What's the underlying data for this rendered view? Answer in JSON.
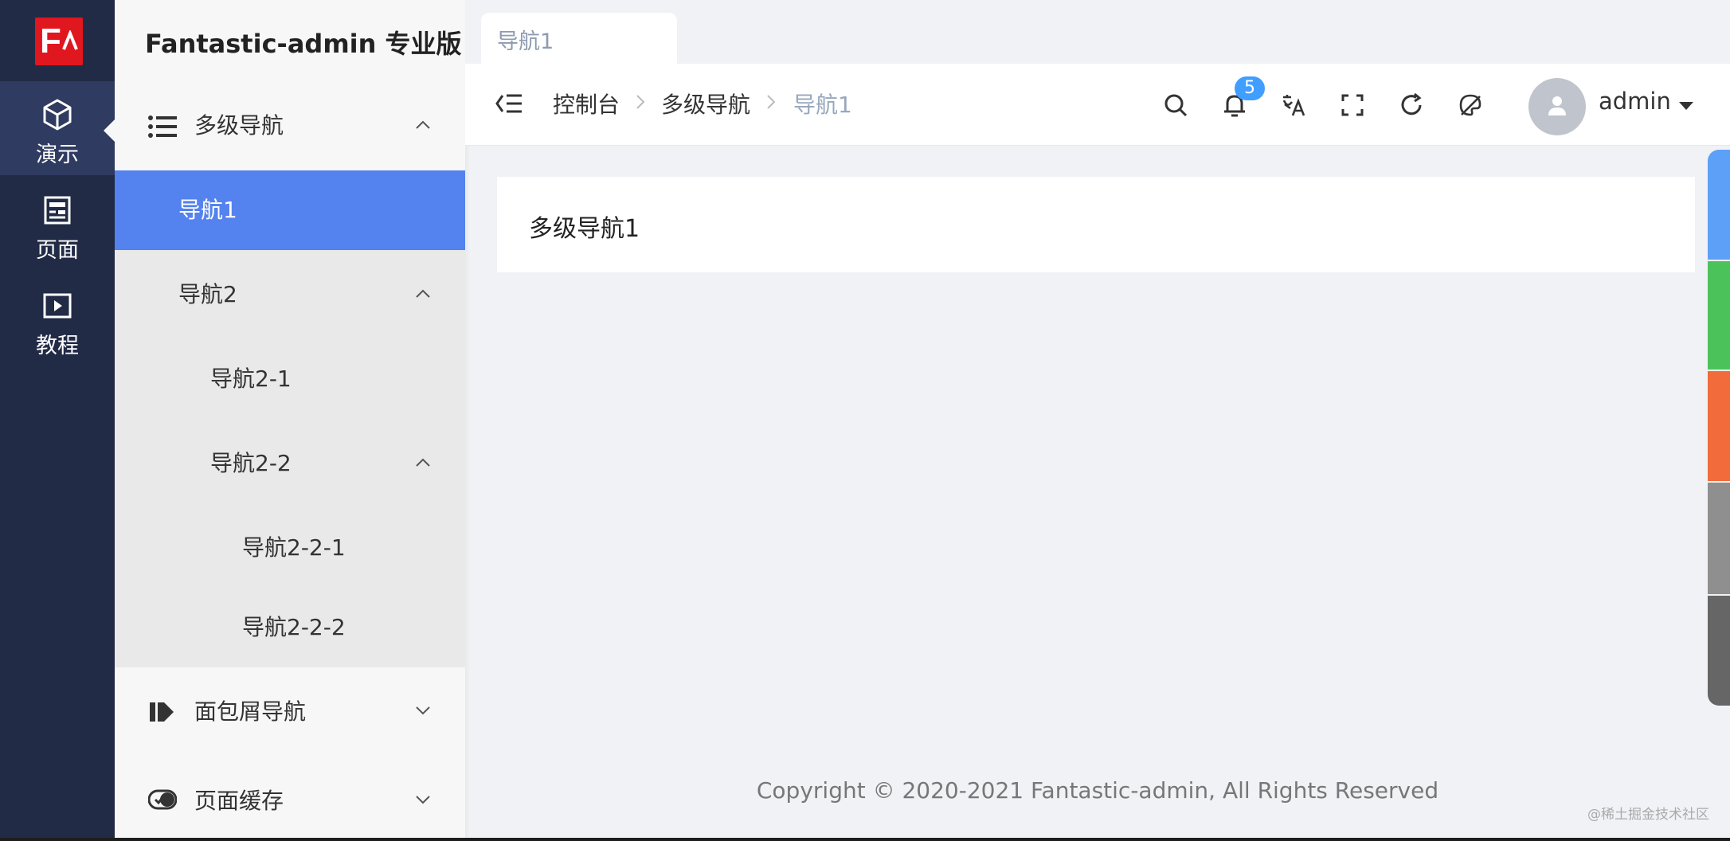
{
  "app": {
    "logo_letter": "F",
    "title": "Fantastic-admin 专业版"
  },
  "main_nav": [
    {
      "label": "演示",
      "icon": "cube-icon",
      "active": true
    },
    {
      "label": "页面",
      "icon": "page-icon",
      "active": false
    },
    {
      "label": "教程",
      "icon": "play-icon",
      "active": false
    }
  ],
  "sidebar": {
    "group": {
      "label": "多级导航",
      "icon": "list-icon"
    },
    "items": [
      {
        "label": "导航1",
        "active": true
      },
      {
        "label": "导航2"
      },
      {
        "label": "导航2-1"
      },
      {
        "label": "导航2-2"
      },
      {
        "label": "导航2-2-1"
      },
      {
        "label": "导航2-2-2"
      }
    ],
    "other_groups": [
      {
        "label": "面包屑导航",
        "icon": "breadcrumb-icon"
      },
      {
        "label": "页面缓存",
        "icon": "cache-icon"
      }
    ]
  },
  "tabs": [
    {
      "label": "导航1"
    }
  ],
  "breadcrumb": [
    "控制台",
    "多级导航",
    "导航1"
  ],
  "toolbar": {
    "notification_count": "5",
    "icons": [
      "search-icon",
      "bell-icon",
      "translate-icon",
      "fullscreen-icon",
      "refresh-icon",
      "theme-icon"
    ]
  },
  "user": {
    "name": "admin"
  },
  "content": {
    "heading": "多级导航1"
  },
  "footer": {
    "copyright": "Copyright © 2020-2021 Fantastic-admin, All Rights Reserved"
  },
  "watermark": "@稀土掘金技术社区",
  "theme_colors": [
    "#5da0f7",
    "#4cc35a",
    "#f26b3a",
    "#8f8f8f",
    "#666666"
  ]
}
